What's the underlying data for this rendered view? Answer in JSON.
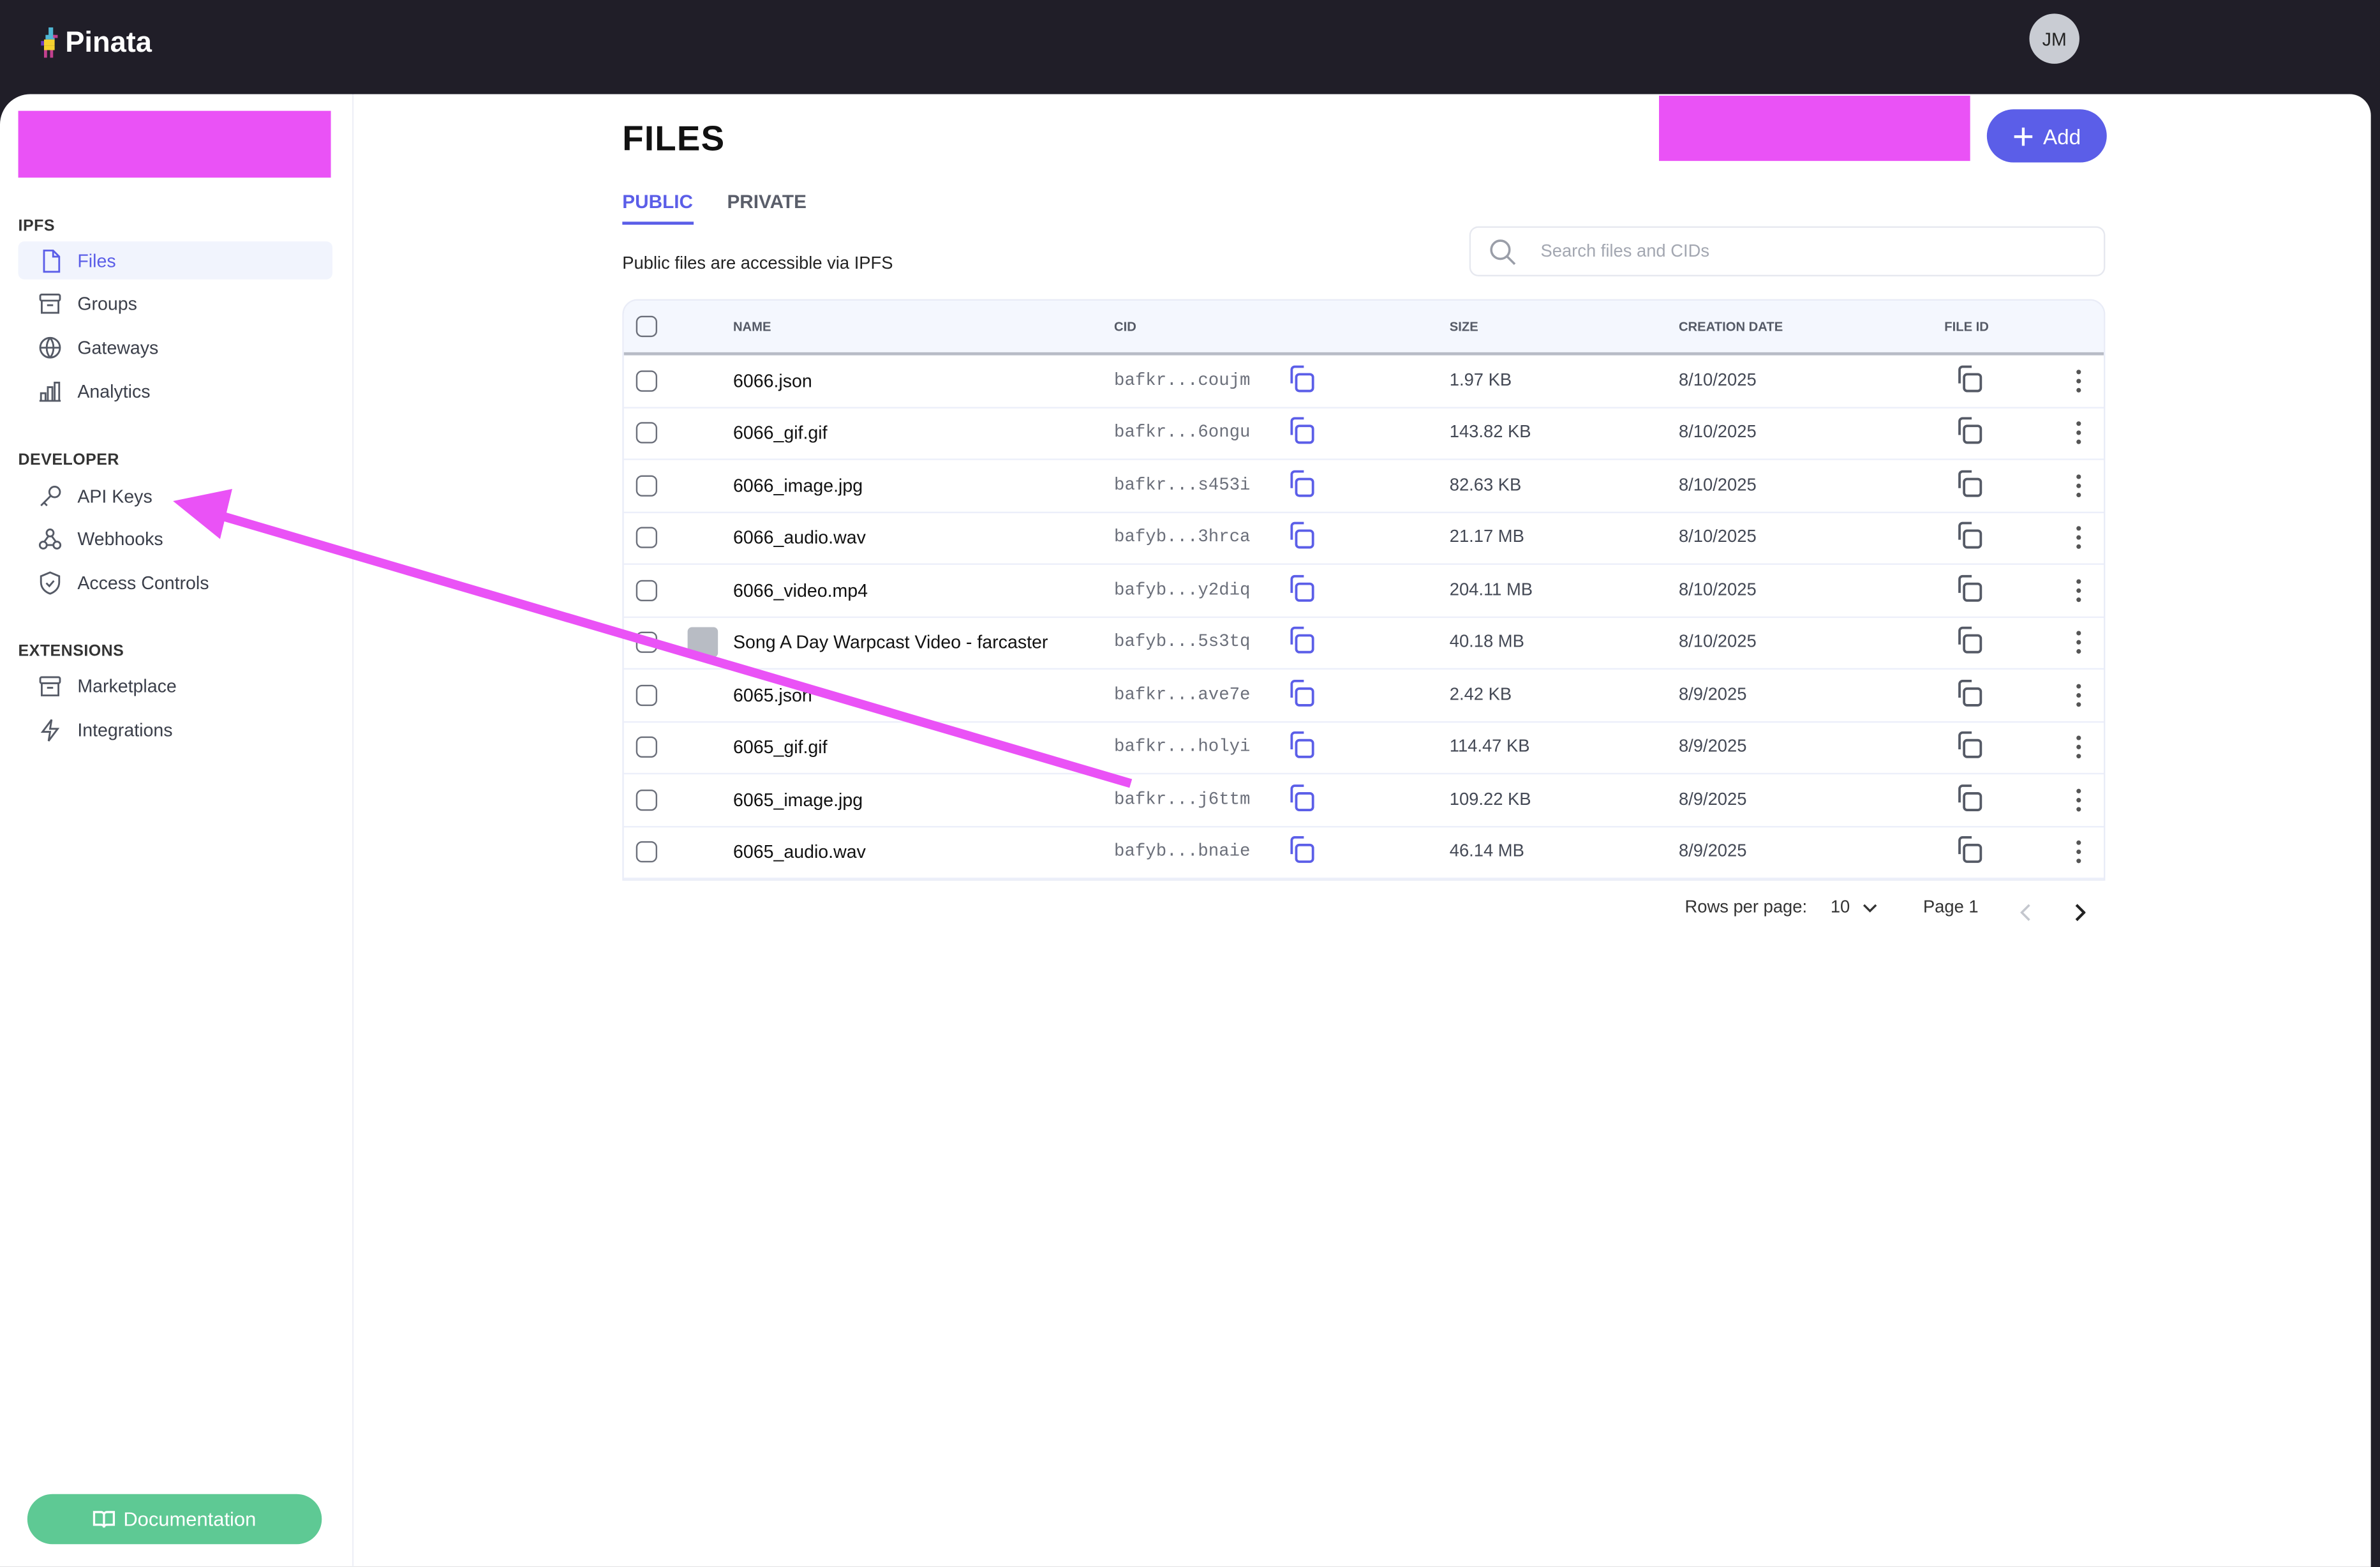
{
  "app": {
    "name": "Pinata",
    "user_initials": "JM"
  },
  "sidebar": {
    "sections": [
      {
        "title": "IPFS",
        "items": [
          {
            "label": "Files",
            "icon": "file-icon",
            "active": true
          },
          {
            "label": "Groups",
            "icon": "archive-icon"
          },
          {
            "label": "Gateways",
            "icon": "globe-icon"
          },
          {
            "label": "Analytics",
            "icon": "bar-chart-icon"
          }
        ]
      },
      {
        "title": "DEVELOPER",
        "items": [
          {
            "label": "API Keys",
            "icon": "key-icon"
          },
          {
            "label": "Webhooks",
            "icon": "webhook-icon"
          },
          {
            "label": "Access Controls",
            "icon": "shield-icon"
          }
        ]
      },
      {
        "title": "EXTENSIONS",
        "items": [
          {
            "label": "Marketplace",
            "icon": "archive-icon"
          },
          {
            "label": "Integrations",
            "icon": "bolt-icon"
          }
        ]
      }
    ],
    "documentation_label": "Documentation"
  },
  "main": {
    "title": "FILES",
    "add_label": "Add",
    "tabs": [
      {
        "label": "PUBLIC",
        "active": true
      },
      {
        "label": "PRIVATE"
      }
    ],
    "subtitle": "Public files are accessible via IPFS",
    "search_placeholder": "Search files and CIDs",
    "columns": {
      "name": "NAME",
      "cid": "CID",
      "size": "SIZE",
      "date": "CREATION DATE",
      "file_id": "FILE ID"
    },
    "rows": [
      {
        "name": "6066.json",
        "cid": "bafkr...coujm",
        "size": "1.97 KB",
        "date": "8/10/2025"
      },
      {
        "name": "6066_gif.gif",
        "cid": "bafkr...6ongu",
        "size": "143.82 KB",
        "date": "8/10/2025"
      },
      {
        "name": "6066_image.jpg",
        "cid": "bafkr...s453i",
        "size": "82.63 KB",
        "date": "8/10/2025"
      },
      {
        "name": "6066_audio.wav",
        "cid": "bafyb...3hrca",
        "size": "21.17 MB",
        "date": "8/10/2025"
      },
      {
        "name": "6066_video.mp4",
        "cid": "bafyb...y2diq",
        "size": "204.11 MB",
        "date": "8/10/2025"
      },
      {
        "name": "Song A Day Warpcast Video - farcaster",
        "cid": "bafyb...5s3tq",
        "size": "40.18 MB",
        "date": "8/10/2025",
        "folder": true
      },
      {
        "name": "6065.json",
        "cid": "bafkr...ave7e",
        "size": "2.42 KB",
        "date": "8/9/2025"
      },
      {
        "name": "6065_gif.gif",
        "cid": "bafkr...holyi",
        "size": "114.47 KB",
        "date": "8/9/2025"
      },
      {
        "name": "6065_image.jpg",
        "cid": "bafkr...j6ttm",
        "size": "109.22 KB",
        "date": "8/9/2025"
      },
      {
        "name": "6065_audio.wav",
        "cid": "bafyb...bnaie",
        "size": "46.14 MB",
        "date": "8/9/2025"
      }
    ],
    "pagination": {
      "rows_per_page_label": "Rows per page:",
      "rows_per_page": "10",
      "page_label": "Page 1"
    }
  },
  "colors": {
    "accent": "#5b5ee8",
    "topbar": "#201e28",
    "doc_button": "#5ec994",
    "annotation": "#ea52f6"
  }
}
